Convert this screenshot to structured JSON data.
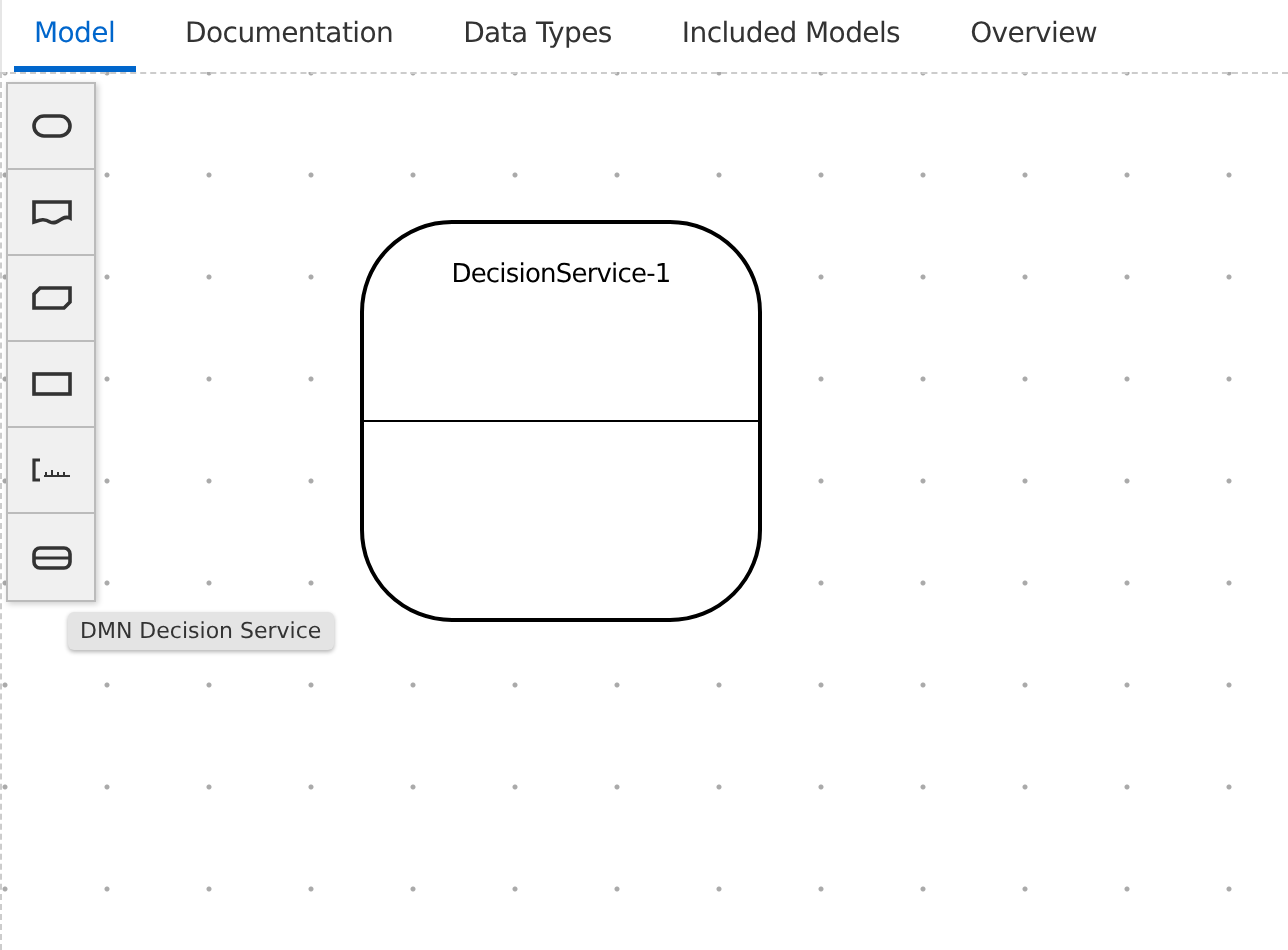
{
  "tabs": [
    {
      "label": "Model",
      "selected": true
    },
    {
      "label": "Documentation",
      "selected": false
    },
    {
      "label": "Data Types",
      "selected": false
    },
    {
      "label": "Included Models",
      "selected": false
    },
    {
      "label": "Overview",
      "selected": false
    }
  ],
  "palette": [
    {
      "kind": "pill"
    },
    {
      "kind": "wave"
    },
    {
      "kind": "cut"
    },
    {
      "kind": "rect"
    },
    {
      "kind": "bracket"
    },
    {
      "kind": "divided"
    }
  ],
  "tooltip": "DMN Decision Service",
  "node": {
    "title": "DecisionService-1"
  }
}
